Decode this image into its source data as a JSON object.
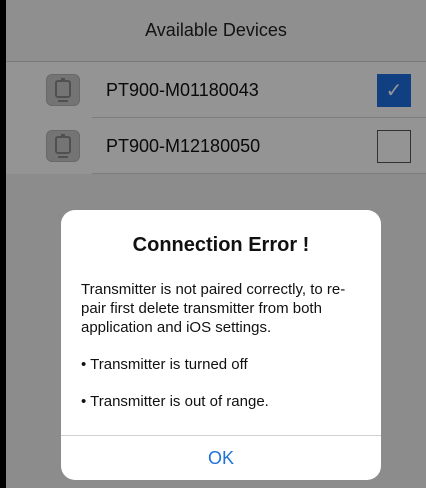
{
  "header": {
    "title": "Available Devices"
  },
  "devices": [
    {
      "name": "PT900-M01180043",
      "checked": true,
      "check_glyph": "✓"
    },
    {
      "name": "PT900-M12180050",
      "checked": false
    }
  ],
  "dialog": {
    "title": "Connection Error !",
    "message": "Transmitter is not paired correctly, to re-pair first delete transmitter from both application and iOS settings.",
    "bullets": [
      "• Transmitter is turned off",
      "• Transmitter is out of range."
    ],
    "ok_label": "OK"
  },
  "colors": {
    "accent": "#1f73d6",
    "checkbox_checked": "#1e6fe0"
  }
}
